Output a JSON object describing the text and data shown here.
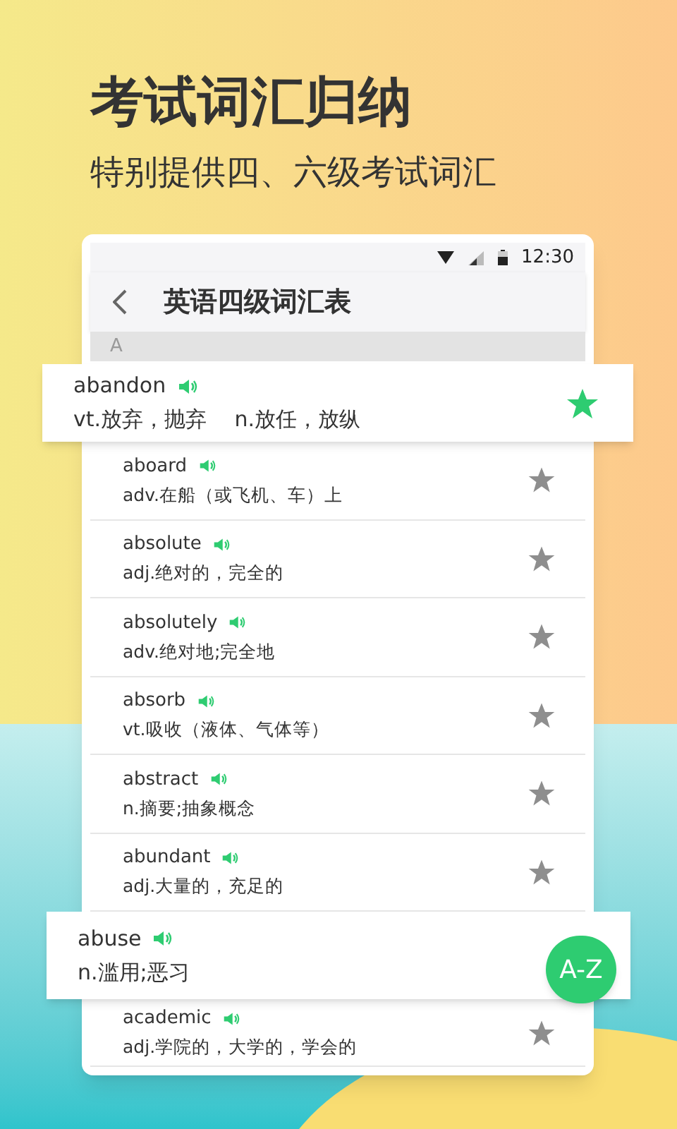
{
  "headline": "考试词汇归纳",
  "subheadline": "特别提供四、六级考试词汇",
  "status_bar": {
    "time": "12:30"
  },
  "header": {
    "title": "英语四级词汇表"
  },
  "section": {
    "letter": "A"
  },
  "words": [
    {
      "kind": "featured",
      "word": "abandon",
      "meaning": "vt.放弃，抛弃　 n.放任，放纵",
      "starred": true
    },
    {
      "kind": "plain",
      "word": "aboard",
      "meaning": "adv.在船（或飞机、车）上",
      "starred": false
    },
    {
      "kind": "plain",
      "word": "absolute",
      "meaning": "adj.绝对的，完全的",
      "starred": false
    },
    {
      "kind": "plain",
      "word": "absolutely",
      "meaning": "adv.绝对地;完全地",
      "starred": false
    },
    {
      "kind": "plain",
      "word": "absorb",
      "meaning": "vt.吸收（液体、气体等）",
      "starred": false
    },
    {
      "kind": "plain",
      "word": "abstract",
      "meaning": "n.摘要;抽象概念",
      "starred": false
    },
    {
      "kind": "plain",
      "word": "abundant",
      "meaning": "adj.大量的，充足的",
      "starred": false
    },
    {
      "kind": "featured",
      "word": "abuse",
      "meaning": "n.滥用;恶习"
    },
    {
      "kind": "plain",
      "word": "academic",
      "meaning": "adj.学院的，大学的，学会的",
      "starred": false
    }
  ],
  "index_button": {
    "label": "A-Z"
  }
}
